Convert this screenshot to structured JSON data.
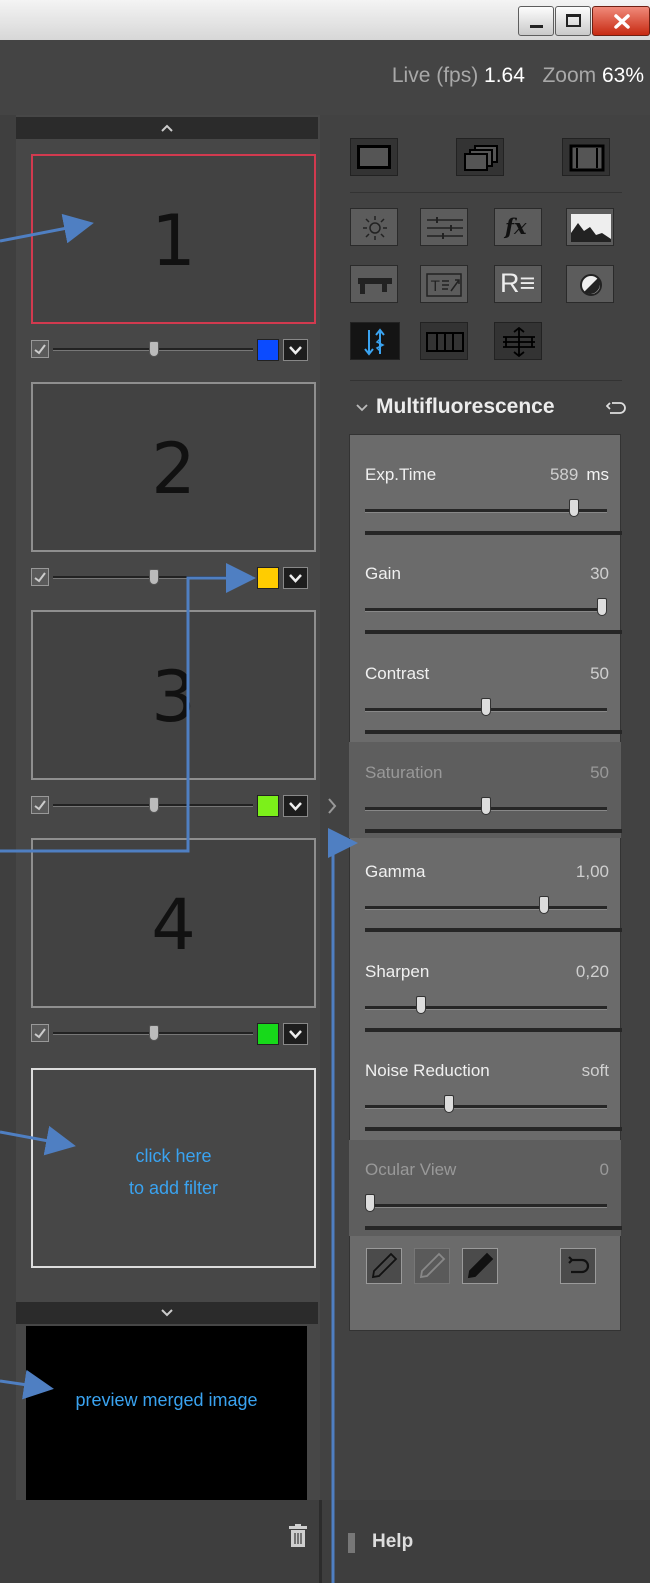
{
  "header": {
    "live_label": "Live (fps)",
    "live_value": "1.64",
    "zoom_label": "Zoom",
    "zoom_value": "63%"
  },
  "filters": [
    {
      "number": "1",
      "color": "#0b4bff",
      "selected": true
    },
    {
      "number": "2",
      "color": "#ffcc00",
      "selected": false
    },
    {
      "number": "3",
      "color": "#7cf01a",
      "selected": false
    },
    {
      "number": "4",
      "color": "#17d91a",
      "selected": false
    }
  ],
  "add_filter": {
    "line1": "click here",
    "line2": "to add filter"
  },
  "preview": {
    "label": "preview merged image"
  },
  "panel": {
    "title": "Multifluorescence",
    "params": [
      {
        "label": "Exp.Time",
        "value": "589",
        "unit": "ms",
        "level": 0.88,
        "enabled": true
      },
      {
        "label": "Gain",
        "value": "30",
        "unit": "",
        "level": 1.0,
        "enabled": true
      },
      {
        "label": "Contrast",
        "value": "50",
        "unit": "",
        "level": 0.5,
        "enabled": true
      },
      {
        "label": "Saturation",
        "value": "50",
        "unit": "",
        "level": 0.5,
        "enabled": false
      },
      {
        "label": "Gamma",
        "value": "1,00",
        "unit": "",
        "level": 0.75,
        "enabled": true
      },
      {
        "label": "Sharpen",
        "value": "0,20",
        "unit": "",
        "level": 0.22,
        "enabled": true
      },
      {
        "label": "Noise Reduction",
        "value": "soft",
        "unit": "",
        "level": 0.34,
        "enabled": true
      },
      {
        "label": "Ocular View",
        "value": "0",
        "unit": "",
        "level": 0.0,
        "enabled": false
      }
    ]
  },
  "footer": {
    "help_label": "Help"
  },
  "colors": {
    "accent": "#3aa3f0",
    "selected_border": "#d23a4f",
    "callout": "#4f7fc2"
  }
}
